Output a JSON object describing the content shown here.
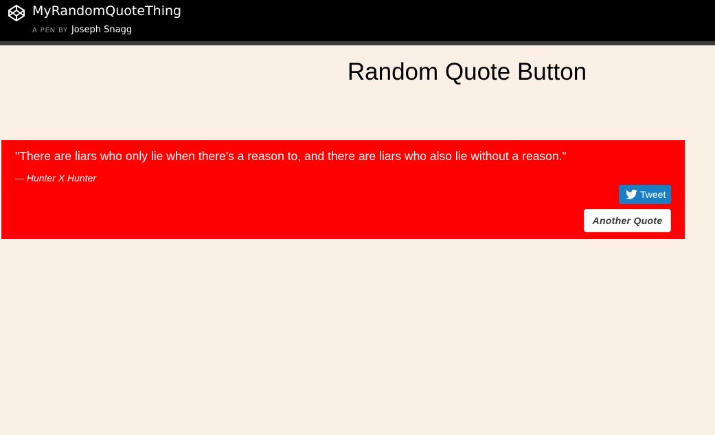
{
  "header": {
    "logo_icon": "codepen-logo-icon",
    "pen_title": "MyRandomQuoteThing",
    "byline_prefix": "A PEN BY",
    "author": "Joseph Snagg"
  },
  "main": {
    "heading": "Random Quote Button",
    "quote": {
      "text": "\"There are liars who only lie when there's a reason to, and there are liars who also lie without a reason.\"",
      "dash": "—",
      "source": "Hunter X Hunter",
      "background_color": "#ff0000"
    },
    "tweet_button": {
      "icon": "twitter-bird-icon",
      "label": "Tweet",
      "color": "#1b7ec2"
    },
    "another_quote_button": {
      "label": "Another Quote"
    }
  },
  "colors": {
    "page_background": "#faf0e6",
    "header_background": "#000000"
  }
}
